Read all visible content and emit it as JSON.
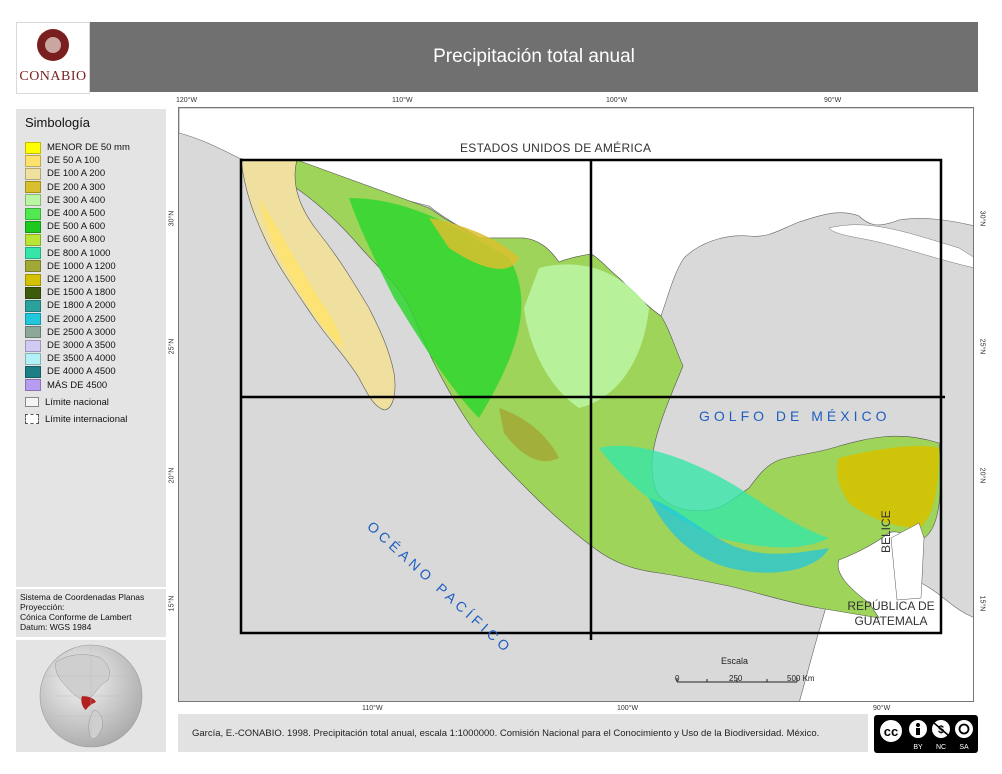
{
  "header": {
    "logo_text": "CONABIO",
    "title": "Precipitación total anual"
  },
  "legend": {
    "title": "Simbología",
    "items": [
      {
        "label": "MENOR DE 50 mm",
        "color": "#ffff00"
      },
      {
        "label": "DE 50 A 100",
        "color": "#fde36e"
      },
      {
        "label": "DE 100 A 200",
        "color": "#efe0a0"
      },
      {
        "label": "DE 200 A 300",
        "color": "#d9bf2e"
      },
      {
        "label": "DE 300 A 400",
        "color": "#b9f5a2"
      },
      {
        "label": "DE 400 A 500",
        "color": "#52e852"
      },
      {
        "label": "DE 500 A 600",
        "color": "#1ec81e"
      },
      {
        "label": "DE 600 A 800",
        "color": "#b9e636"
      },
      {
        "label": "DE 800 A 1000",
        "color": "#36e6a8"
      },
      {
        "label": "DE 1000 A 1200",
        "color": "#a2a836"
      },
      {
        "label": "DE 1200 A 1500",
        "color": "#d4c200"
      },
      {
        "label": "DE 1500 A 1800",
        "color": "#3d5a0d"
      },
      {
        "label": "DE 1800 A 2000",
        "color": "#2aa19a"
      },
      {
        "label": "DE 2000 A 2500",
        "color": "#22c7dc"
      },
      {
        "label": "DE 2500 A 3000",
        "color": "#8da79a"
      },
      {
        "label": "DE 3000 A 3500",
        "color": "#d2c9f4"
      },
      {
        "label": "DE 3500 A 4000",
        "color": "#b2f2f6"
      },
      {
        "label": "DE 4000 A 4500",
        "color": "#1c7f86"
      },
      {
        "label": "MÁS DE 4500",
        "color": "#b79cf2"
      }
    ],
    "line_items": [
      {
        "label": "Límite nacional"
      },
      {
        "label": "Límite internacional"
      }
    ]
  },
  "projection": {
    "lines": [
      "Sistema de Coordenadas Planas",
      "Proyección:",
      "Cónica Conforme de Lambert",
      "Datum: WGS 1984"
    ]
  },
  "map": {
    "top_ticks": [
      "120°W",
      "110°W",
      "100°W",
      "90°W"
    ],
    "bottom_ticks": [
      "110°W",
      "100°W",
      "90°W"
    ],
    "left_ticks": [
      "30°N",
      "25°N",
      "20°N",
      "15°N"
    ],
    "right_ticks": [
      "30°N",
      "25°N",
      "20°N",
      "15°N"
    ],
    "labels": {
      "usa": "ESTADOS UNIDOS DE AMÉRICA",
      "gulf": "GOLFO DE MÉXICO",
      "pacific": "OCÉANO PACÍFICO",
      "belize": "BELICE",
      "guatemala_line1": "REPÚBLICA DE",
      "guatemala_line2": "GUATEMALA"
    },
    "ocean_label_color": "#1f5fc0"
  },
  "scale": {
    "title": "Escala",
    "ticks": [
      "0",
      "250",
      "500 Km"
    ]
  },
  "footer": {
    "credit": "García, E.-CONABIO. 1998. Precipitación total anual, escala 1:1000000. Comisión Nacional para el Conocimiento y Uso de la Biodiversidad. México.",
    "license_labels": [
      "BY",
      "NC",
      "SA"
    ],
    "cc_text": "cc"
  }
}
